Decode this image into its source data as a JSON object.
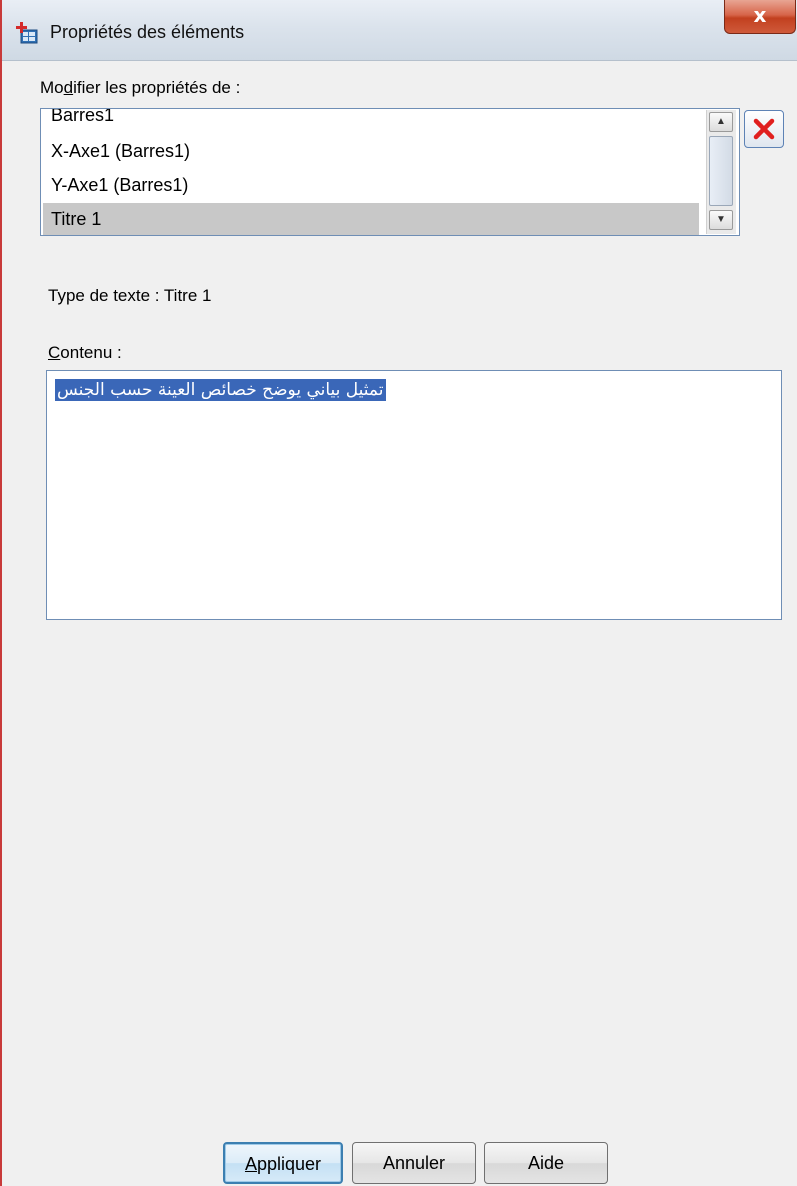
{
  "window": {
    "title": "Propriétés des éléments",
    "close_glyph": "x"
  },
  "modify": {
    "label_prefix": "Mo",
    "label_underlined": "d",
    "label_suffix": "ifier les propriétés de :",
    "items": [
      {
        "label": "Barres1",
        "selected": false
      },
      {
        "label": "X-Axe1 (Barres1)",
        "selected": false
      },
      {
        "label": "Y-Axe1 (Barres1)",
        "selected": false
      },
      {
        "label": "Titre 1",
        "selected": true
      }
    ],
    "delete_icon": "red-x-icon"
  },
  "text_type": {
    "label": "Type de texte : Titre 1"
  },
  "content": {
    "label_underlined": "C",
    "label_suffix": "ontenu :",
    "value": "تمثيل بياني يوضح خصائص العينة حسب الجنس"
  },
  "buttons": {
    "apply_underlined": "A",
    "apply_suffix": "ppliquer",
    "cancel": "Annuler",
    "help": "Aide"
  },
  "colors": {
    "selection": "#3a67b8",
    "delete_icon": "#e02020",
    "close_button": "#c2401f"
  }
}
